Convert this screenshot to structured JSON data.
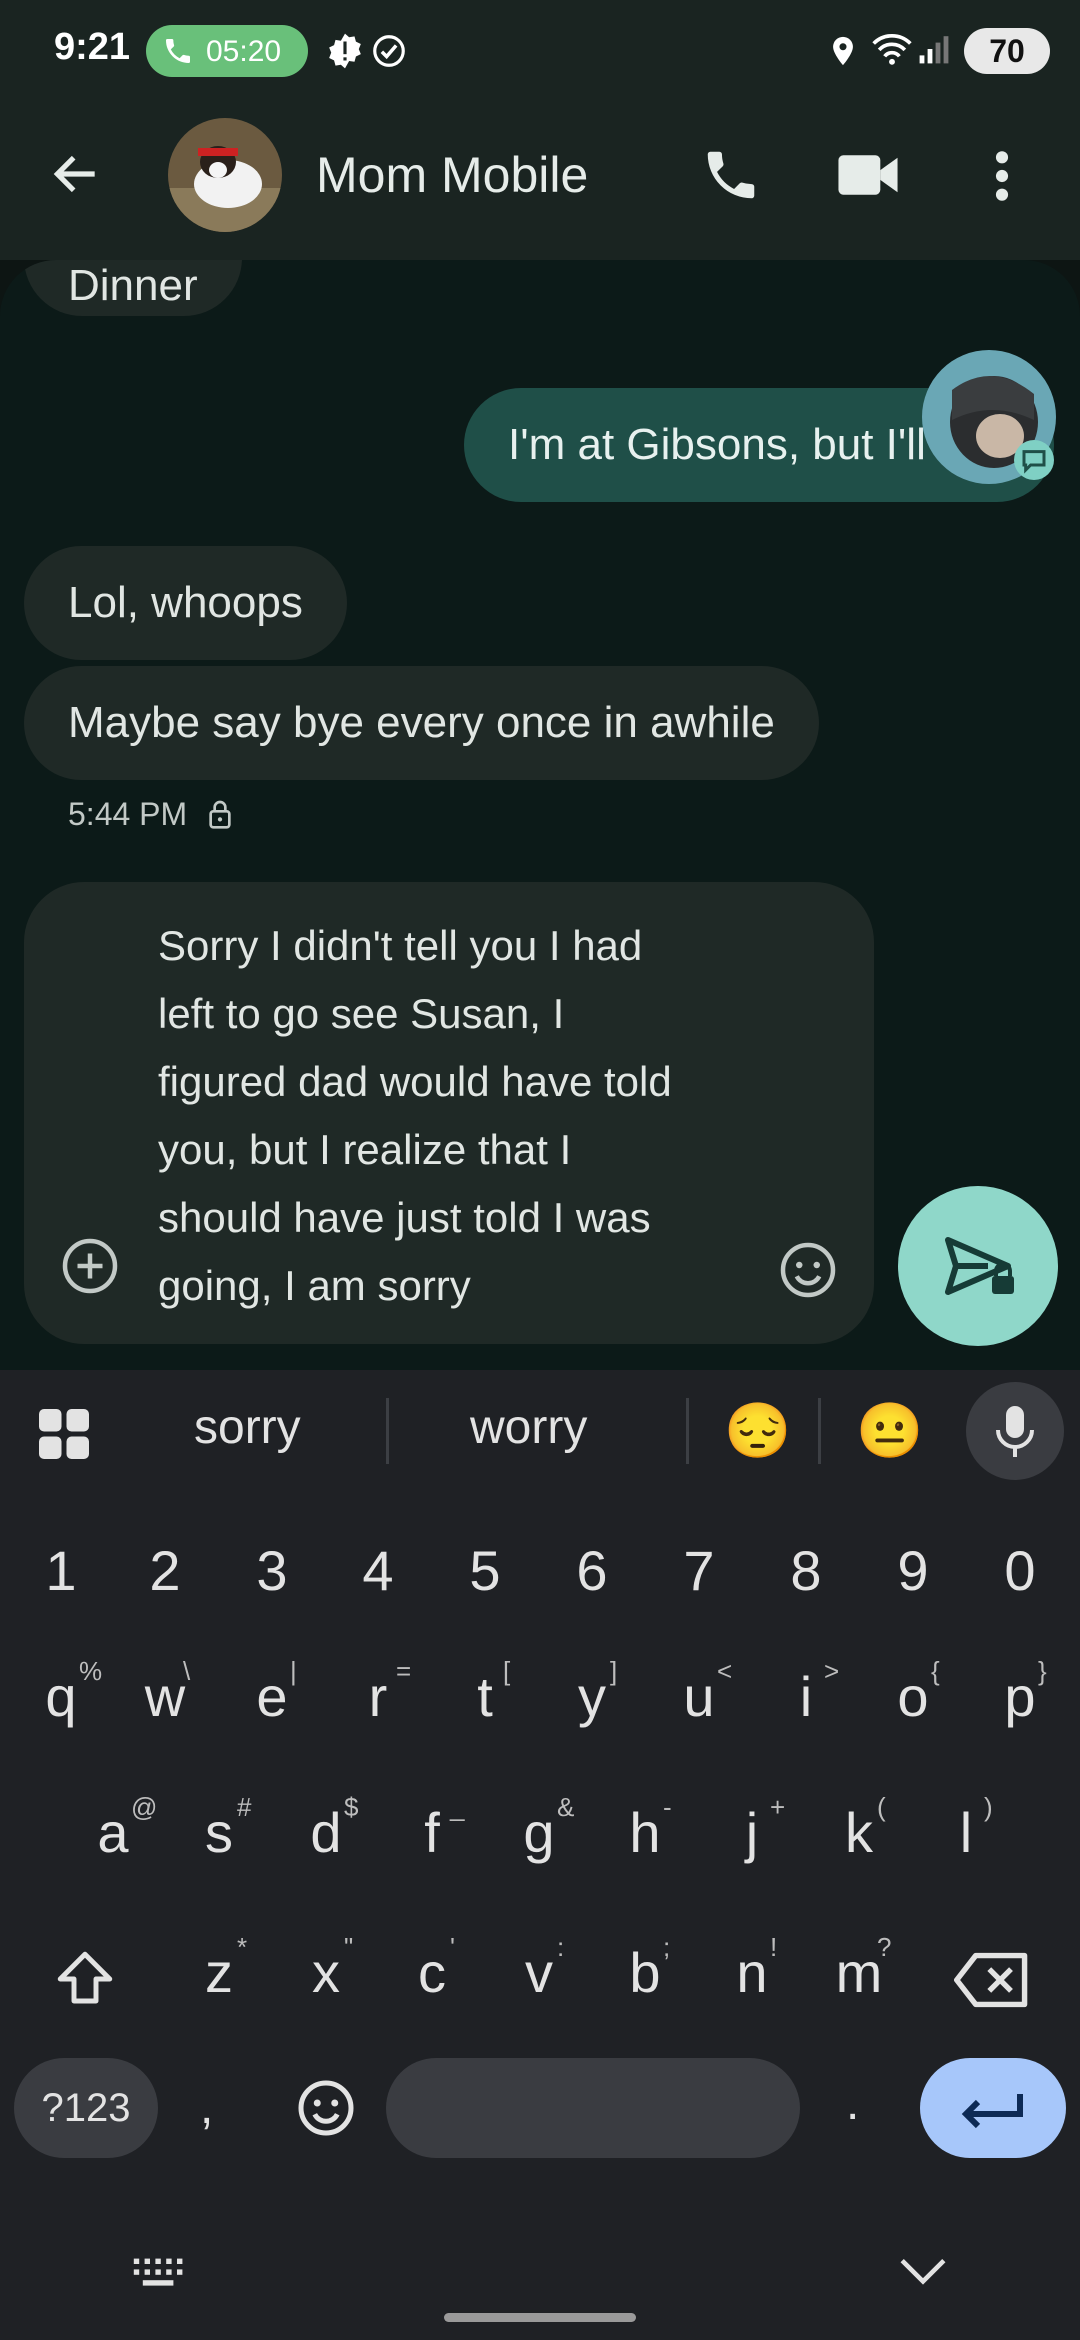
{
  "status_bar": {
    "time": "9:21",
    "call_timer": "05:20",
    "battery": "70"
  },
  "header": {
    "contact_name": "Mom Mobile"
  },
  "messages": [
    {
      "direction": "incoming",
      "text": "Dinner"
    },
    {
      "direction": "outgoing",
      "text": "I'm at Gibsons, but I'll"
    },
    {
      "direction": "incoming",
      "text": "Lol, whoops"
    },
    {
      "direction": "incoming",
      "text": "Maybe say bye every once in awhile"
    }
  ],
  "message_time": "5:44 PM",
  "composer": {
    "lines": [
      "Sorry I didn't tell you I had",
      "left to go see Susan, I",
      "figured dad would have told",
      "you, but I realize that I",
      "should have just told I was",
      "going, I am sorry"
    ]
  },
  "keyboard": {
    "suggestions": [
      "sorry",
      "worry"
    ],
    "emoji_suggestions": [
      "😔",
      "😐"
    ],
    "number_row": [
      "1",
      "2",
      "3",
      "4",
      "5",
      "6",
      "7",
      "8",
      "9",
      "0"
    ],
    "row1": [
      "q",
      "w",
      "e",
      "r",
      "t",
      "y",
      "u",
      "i",
      "o",
      "p"
    ],
    "row1_hints": [
      "%",
      "\\",
      "|",
      "=",
      "[",
      "]",
      "<",
      ">",
      "{",
      "}"
    ],
    "row2": [
      "a",
      "s",
      "d",
      "f",
      "g",
      "h",
      "j",
      "k",
      "l"
    ],
    "row2_hints": [
      "@",
      "#",
      "$",
      "_",
      "&",
      "-",
      "+",
      "(",
      ")"
    ],
    "row3": [
      "z",
      "x",
      "c",
      "v",
      "b",
      "n",
      "m"
    ],
    "row3_hints": [
      "*",
      "\"",
      "'",
      ":",
      ";",
      "!",
      "?"
    ],
    "symbols_label": "?123",
    "comma": ",",
    "period": "."
  },
  "colors": {
    "accent": "#8fd7c9",
    "enter_key": "#a7c7fa",
    "outgoing_bubble": "#1f4f48"
  }
}
